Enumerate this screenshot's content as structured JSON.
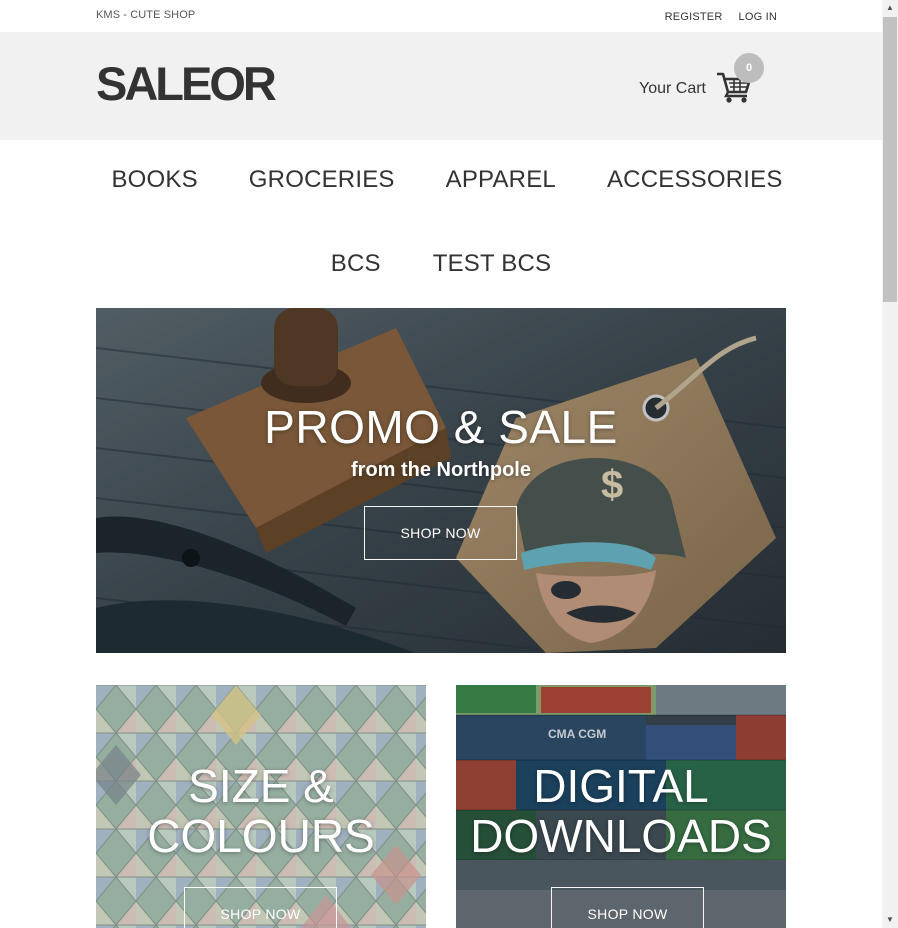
{
  "topbar": {
    "shop_name": "KMS - CUTE SHOP",
    "register": "REGISTER",
    "login": "LOG IN"
  },
  "header": {
    "logo": "SALEOR",
    "cart_label": "Your Cart",
    "cart_count": "0",
    "cart_icon": "cart-icon"
  },
  "nav": {
    "row1": [
      "BOOKS",
      "GROCERIES",
      "APPAREL",
      "ACCESSORIES"
    ],
    "row2": [
      "BCS",
      "TEST BCS"
    ]
  },
  "hero": {
    "title": "PROMO & SALE",
    "subtitle": "from the Northpole",
    "button": "SHOP NOW"
  },
  "tiles": [
    {
      "title_line1": "SIZE &",
      "title_line2": "COLOURS",
      "button": "SHOP NOW"
    },
    {
      "title_line1": "DIGITAL",
      "title_line2": "DOWNLOADS",
      "button": "SHOP NOW"
    }
  ],
  "colors": {
    "header_bg": "#f1f1f1",
    "badge": "#bdbdbd",
    "text": "#333333"
  }
}
